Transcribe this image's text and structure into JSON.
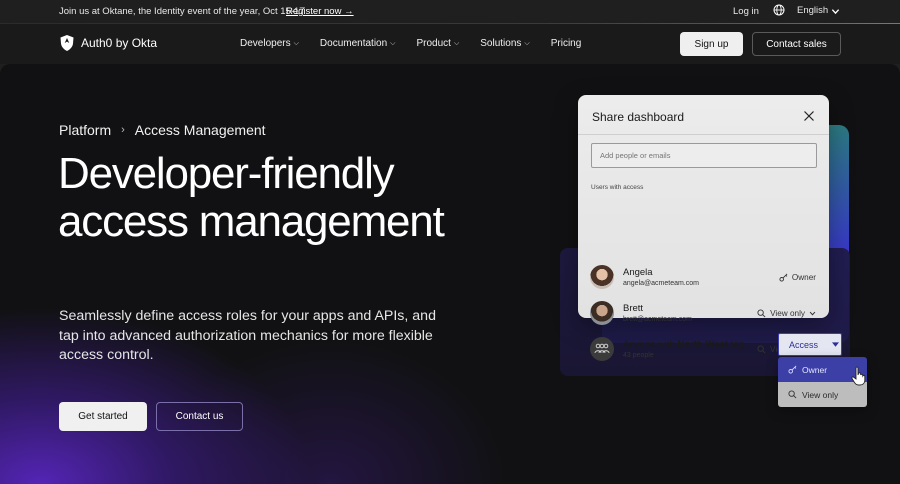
{
  "topbar": {
    "announcement": "Join us at Oktane, the Identity event of the year, Oct 15-17",
    "register_link": "Register now →",
    "login": "Log in",
    "language": "English"
  },
  "nav": {
    "logo": "Auth0 by Okta",
    "links": [
      {
        "label": "Developers",
        "has_menu": true
      },
      {
        "label": "Documentation",
        "has_menu": true
      },
      {
        "label": "Product",
        "has_menu": true
      },
      {
        "label": "Solutions",
        "has_menu": true
      },
      {
        "label": "Pricing",
        "has_menu": false
      }
    ],
    "signup": "Sign up",
    "contact_sales": "Contact sales"
  },
  "hero": {
    "breadcrumb": [
      "Platform",
      "Access Management"
    ],
    "headline": "Developer-friendly access management",
    "subtext": "Seamlessly define access roles for your apps and APIs, and tap into advanced authorization mechanics for more flexible access control.",
    "cta_primary": "Get started",
    "cta_secondary": "Contact us"
  },
  "dialog": {
    "title": "Share dashboard",
    "input_placeholder": "Add people or emails",
    "section_label": "Users with access",
    "users": [
      {
        "name": "Angela",
        "email": "angela@acmeteam.com",
        "role": "Owner",
        "role_icon": "key-icon"
      },
      {
        "name": "Brett",
        "email": "brett@acmeteam.com",
        "role": "View only",
        "role_icon": "magnifier-icon"
      },
      {
        "name_prefix": "Anyone with ",
        "name_bold": "North West",
        "name_suffix": " tag",
        "email": "43 people",
        "role": "View",
        "role_icon": "magnifier-icon"
      }
    ],
    "access_button": "Access",
    "dropdown": [
      {
        "label": "Owner",
        "icon": "key-icon",
        "selected": true
      },
      {
        "label": "View only",
        "icon": "magnifier-icon",
        "selected": false
      }
    ]
  },
  "colors": {
    "accent": "#3d3fb3",
    "background": "#111113",
    "glow_purple": "#6028d2"
  }
}
